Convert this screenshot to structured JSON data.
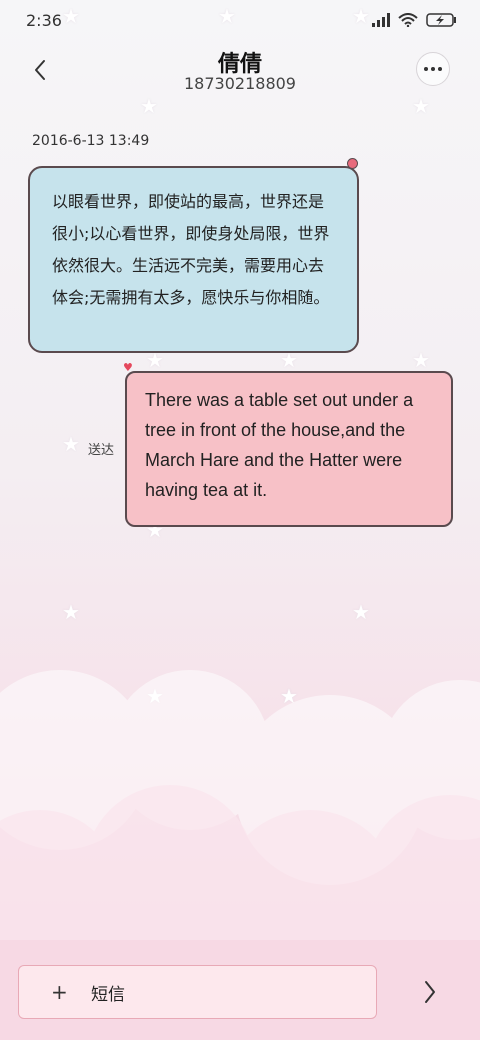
{
  "status_bar": {
    "time": "2:36",
    "icons": [
      "signal-icon",
      "wifi-icon",
      "battery-charging-icon"
    ]
  },
  "header": {
    "contact_name": "倩倩",
    "phone_number": "18730218809",
    "back_icon": "chevron-left-icon",
    "more_icon": "more-dots-icon"
  },
  "conversation": {
    "timestamp": "2016-6-13 13:49",
    "messages": [
      {
        "direction": "incoming",
        "text": "以眼看世界，即使站的最高，世界还是很小;以心看世界，即使身处局限，世界依然很大。生活远不完美，需要用心去体会;无需拥有太多，愿快乐与你相随。"
      },
      {
        "direction": "outgoing",
        "text": "There was a table set out under a tree in front of the house,and the March Hare and the Hatter were having tea at it.",
        "status": "送达"
      }
    ]
  },
  "composer": {
    "plus_label": "+",
    "placeholder": "短信",
    "send_icon": "chevron-right-icon"
  },
  "colors": {
    "incoming_bubble": "#c6e3ec",
    "outgoing_bubble": "#f7c1c7",
    "bubble_border": "#5a4a4e",
    "accent_dot": "#e86a7c"
  }
}
